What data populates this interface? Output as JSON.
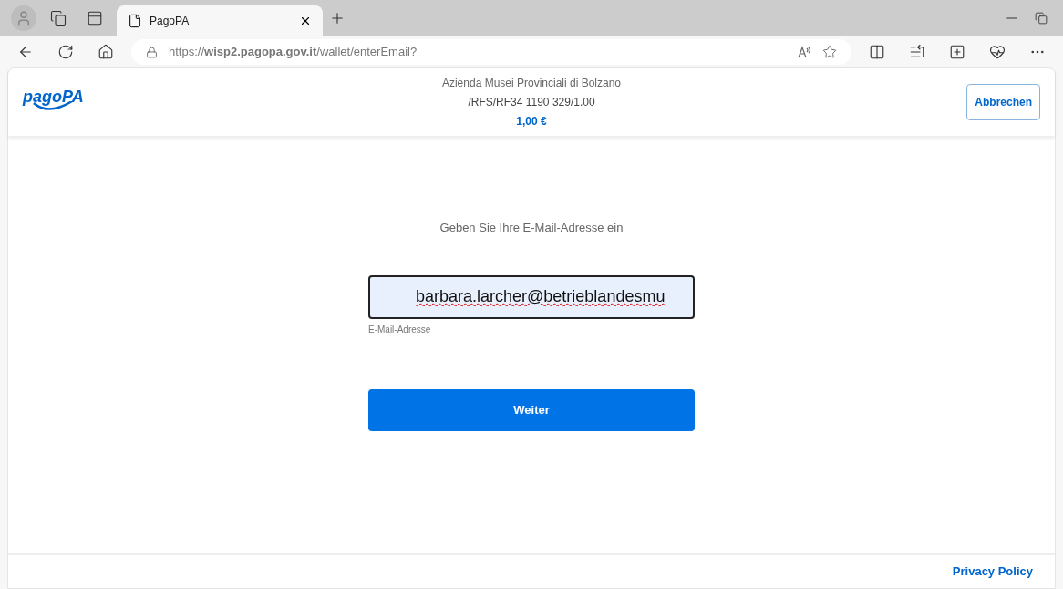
{
  "browser": {
    "tab": {
      "title": "PagoPA",
      "selected": true
    },
    "address": "https://**wisp2.pagopa.gov.it**/wallet/enterEmail?"
  },
  "header": {
    "logo": "pagoPA",
    "payee": "Azienda Musei Provinciali di Bolzano",
    "reference": "/RFS/RF34 1190 329/1.00",
    "amount": "1,00 €",
    "cancel_button": "Abbrechen"
  },
  "form": {
    "prompt": "Geben Sie Ihre E-Mail-Adresse ein",
    "email": {
      "value": "barbara.larcher@betrieblandesmu",
      "label": "E-Mail-Adresse"
    },
    "submit_button": "Weiter"
  },
  "footer": {
    "link": "Privacy Policy"
  }
}
